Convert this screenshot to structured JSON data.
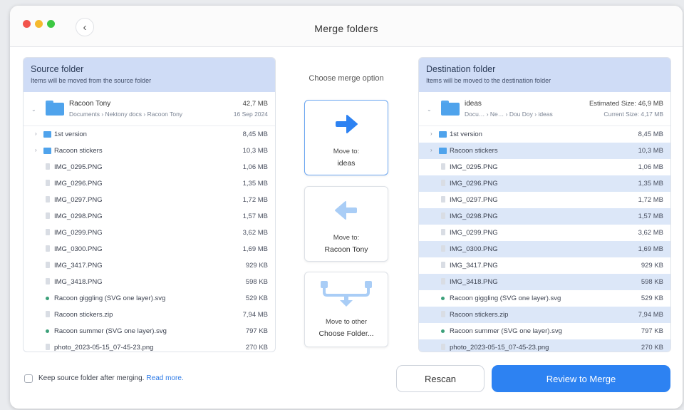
{
  "window": {
    "title": "Merge folders"
  },
  "source": {
    "title": "Source folder",
    "subtitle": "Items will be moved from the source folder",
    "root": {
      "name": "Racoon Tony",
      "path": "Documents › Nektony docs › Racoon Tony",
      "size": "42,7 MB",
      "date": "16 Sep 2024"
    },
    "items": [
      {
        "name": "1st version",
        "size": "8,45 MB",
        "type": "folder"
      },
      {
        "name": "Racoon stickers",
        "size": "10,3 MB",
        "type": "folder"
      },
      {
        "name": "IMG_0295.PNG",
        "size": "1,06 MB",
        "type": "file"
      },
      {
        "name": "IMG_0296.PNG",
        "size": "1,35 MB",
        "type": "file"
      },
      {
        "name": "IMG_0297.PNG",
        "size": "1,72 MB",
        "type": "file"
      },
      {
        "name": "IMG_0298.PNG",
        "size": "1,57 MB",
        "type": "file"
      },
      {
        "name": "IMG_0299.PNG",
        "size": "3,62 MB",
        "type": "file"
      },
      {
        "name": "IMG_0300.PNG",
        "size": "1,69 MB",
        "type": "file"
      },
      {
        "name": "IMG_3417.PNG",
        "size": "929 KB",
        "type": "file"
      },
      {
        "name": "IMG_3418.PNG",
        "size": "598 KB",
        "type": "file"
      },
      {
        "name": "Racoon giggling (SVG one layer).svg",
        "size": "529 KB",
        "type": "svg"
      },
      {
        "name": "Racoon stickers.zip",
        "size": "7,94 MB",
        "type": "file"
      },
      {
        "name": "Racoon summer (SVG one layer).svg",
        "size": "797 KB",
        "type": "svg"
      },
      {
        "name": "photo_2023-05-15_07-45-23.png",
        "size": "270 KB",
        "type": "file"
      }
    ]
  },
  "destination": {
    "title": "Destination folder",
    "subtitle": "Items will be moved to the destination folder",
    "root": {
      "name": "ideas",
      "path": "Docu… › Ne… › Dou Doy › ideas",
      "size": "Estimated Size: 46,9 MB",
      "date": "Current Size: 4,17 MB"
    },
    "items": [
      {
        "name": "1st version",
        "size": "8,45 MB",
        "type": "folder"
      },
      {
        "name": "Racoon stickers",
        "size": "10,3 MB",
        "type": "folder"
      },
      {
        "name": "IMG_0295.PNG",
        "size": "1,06 MB",
        "type": "file"
      },
      {
        "name": "IMG_0296.PNG",
        "size": "1,35 MB",
        "type": "file"
      },
      {
        "name": "IMG_0297.PNG",
        "size": "1,72 MB",
        "type": "file"
      },
      {
        "name": "IMG_0298.PNG",
        "size": "1,57 MB",
        "type": "file"
      },
      {
        "name": "IMG_0299.PNG",
        "size": "3,62 MB",
        "type": "file"
      },
      {
        "name": "IMG_0300.PNG",
        "size": "1,69 MB",
        "type": "file"
      },
      {
        "name": "IMG_3417.PNG",
        "size": "929 KB",
        "type": "file"
      },
      {
        "name": "IMG_3418.PNG",
        "size": "598 KB",
        "type": "file"
      },
      {
        "name": "Racoon giggling (SVG one layer).svg",
        "size": "529 KB",
        "type": "svg"
      },
      {
        "name": "Racoon stickers.zip",
        "size": "7,94 MB",
        "type": "file"
      },
      {
        "name": "Racoon summer (SVG one layer).svg",
        "size": "797 KB",
        "type": "svg"
      },
      {
        "name": "photo_2023-05-15_07-45-23.png",
        "size": "270 KB",
        "type": "file"
      }
    ]
  },
  "merge": {
    "label": "Choose merge option",
    "options": [
      {
        "line1": "Move to:",
        "line2": "ideas",
        "icon": "arrow-right-icon"
      },
      {
        "line1": "Move to:",
        "line2": "Racoon Tony",
        "icon": "arrow-left-icon"
      },
      {
        "line1": "Move to other",
        "line2": "Choose Folder...",
        "icon": "merge-down-icon"
      }
    ]
  },
  "footer": {
    "keep_label": "Keep source folder after merging.",
    "read_more": "Read more.",
    "rescan": "Rescan",
    "review": "Review to Merge"
  },
  "colors": {
    "accent": "#2d82f2",
    "panel_header": "#cfdcf6",
    "row_highlight": "#dce7f8",
    "folder": "#4fa3ec"
  }
}
